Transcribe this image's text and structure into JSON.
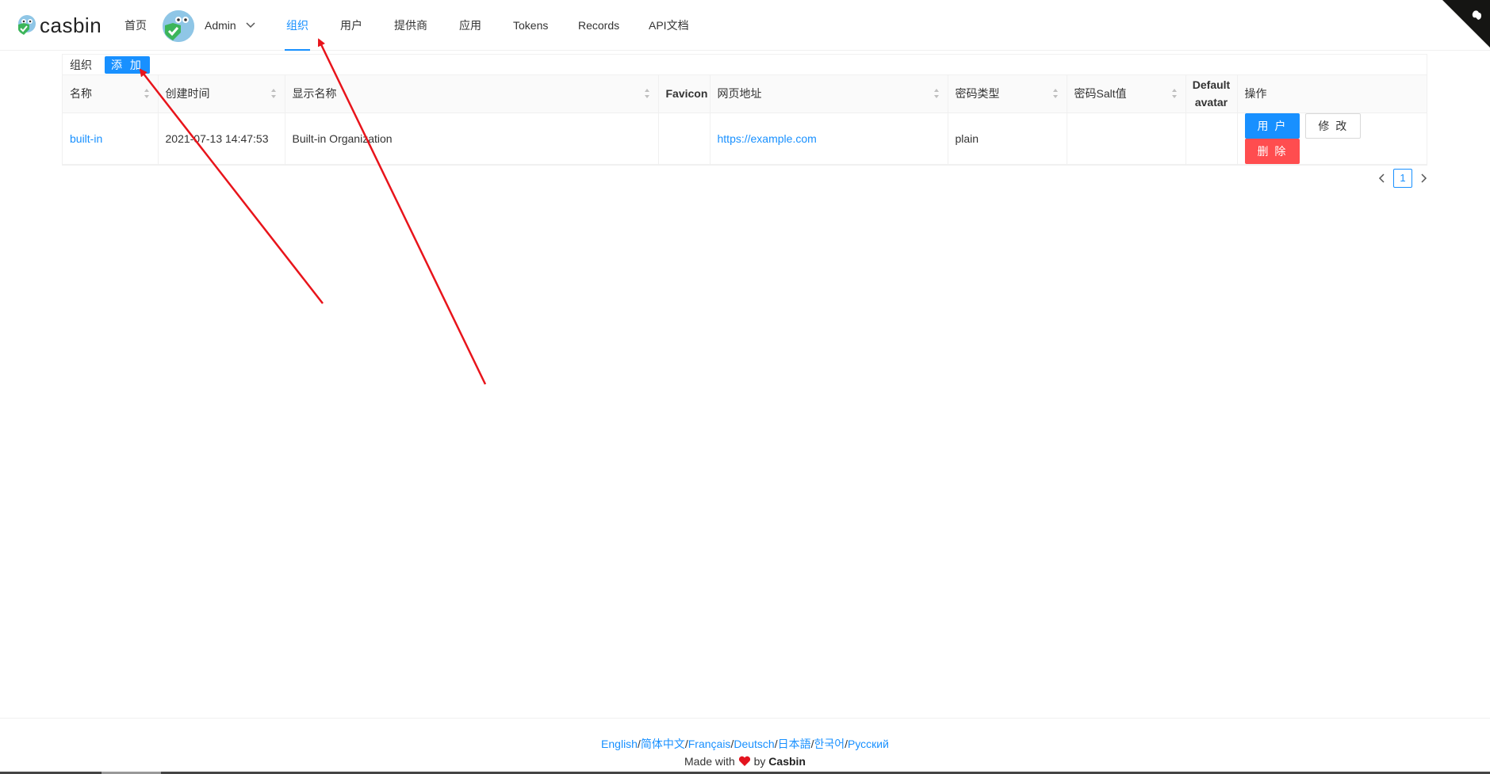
{
  "brand": {
    "name": "casbin"
  },
  "nav": {
    "home": "首页",
    "admin": "Admin",
    "organizations": "组织",
    "users": "用户",
    "providers": "提供商",
    "applications": "应用",
    "tokens": "Tokens",
    "records": "Records",
    "api_docs": "API文档",
    "active": "组织"
  },
  "table": {
    "title": "组织",
    "add_label": "添 加",
    "columns": [
      "名称",
      "创建时间",
      "显示名称",
      "Favicon",
      "网页地址",
      "密码类型",
      "密码Salt值",
      "Default avatar",
      "操作"
    ],
    "rows": [
      {
        "name": "built-in",
        "created_time": "2021-07-13 14:47:53",
        "display_name": "Built-in Organization",
        "favicon": "",
        "website": "https://example.com",
        "password_type": "plain",
        "password_salt": "",
        "default_avatar": "",
        "actions": {
          "users": "用 户",
          "edit": "修 改",
          "delete": "删 除"
        }
      }
    ]
  },
  "pagination": {
    "current": "1"
  },
  "footer": {
    "languages": [
      "English",
      "简体中文",
      "Français",
      "Deutsch",
      "日本語",
      "한국어",
      "Русский"
    ],
    "made_with": "Made with",
    "by": "by",
    "author": "Casbin"
  },
  "colors": {
    "primary": "#1890ff",
    "danger": "#ff4d4f",
    "annotation_arrow": "#e8141b"
  }
}
